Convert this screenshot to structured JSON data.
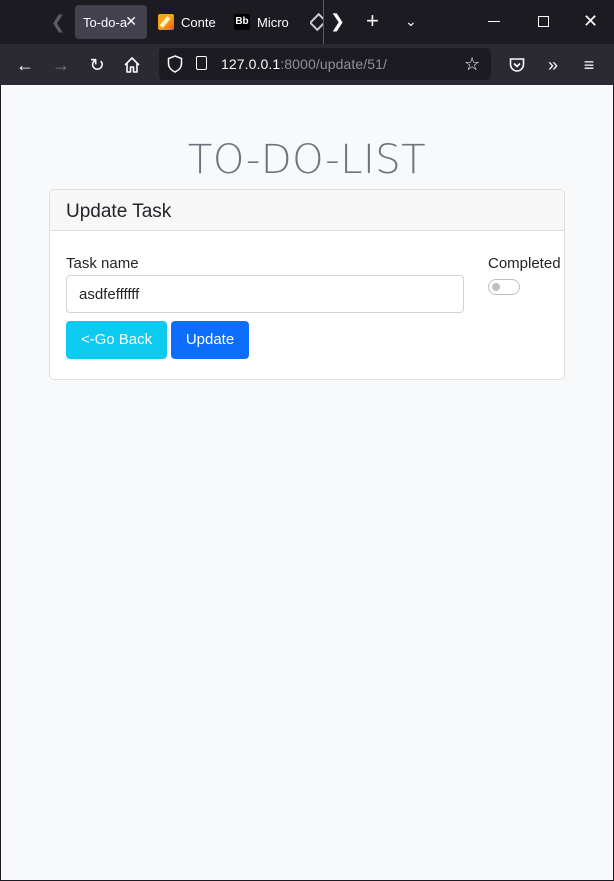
{
  "browser": {
    "tabs": [
      {
        "title": "To-do-a",
        "active": true
      },
      {
        "title": "Conte",
        "active": false,
        "icon": "pencil-favicon"
      },
      {
        "title": "Micro",
        "active": false,
        "icon": "bb-favicon"
      },
      {
        "title": "",
        "active": false,
        "icon": "diamond-favicon"
      }
    ],
    "tab_close_glyph": "✕",
    "url_host": "127.0.0.1",
    "url_rest": ":8000/update/51/"
  },
  "page": {
    "title": "TO-DO-LIST",
    "card_header": "Update Task",
    "task_label": "Task name",
    "task_value": "asdfeffffff",
    "completed_label": "Completed",
    "completed_checked": false,
    "back_button": "<-Go Back",
    "update_button": "Update"
  },
  "colors": {
    "info_button": "#0dcaf0",
    "primary_button": "#0d6efd",
    "page_background": "#f8f9fa",
    "chrome_dark": "#1c1b22"
  }
}
